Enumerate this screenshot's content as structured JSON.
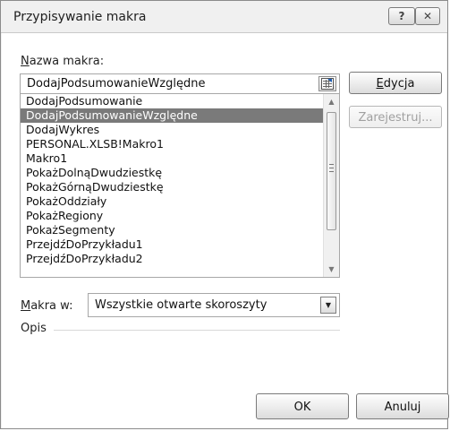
{
  "window": {
    "title": "Przypisywanie makra",
    "help_symbol": "?",
    "close_symbol": "✕"
  },
  "macro_name": {
    "label": "Nazwa makra:",
    "value": "DodajPodsumowanieWzględne"
  },
  "macros_list": {
    "items": [
      "DodajPodsumowanie",
      "DodajPodsumowanieWzględne",
      "DodajWykres",
      "PERSONAL.XLSB!Makro1",
      "Makro1",
      "PokażDolnąDwudziestkę",
      "PokażGórnąDwudziestkę",
      "PokażOddziały",
      "PokażRegiony",
      "PokażSegmenty",
      "PrzejdźDoPrzykładu1",
      "PrzejdźDoPrzykładu2"
    ],
    "selected_index": 1
  },
  "buttons": {
    "edit": "Edycja",
    "record": "Zarejestruj...",
    "ok": "OK",
    "cancel": "Anuluj"
  },
  "macros_in": {
    "label": "Makra w:",
    "selected": "Wszystkie otwarte skoroszyty"
  },
  "description": {
    "label": "Opis"
  },
  "icons": {
    "help": "help-icon",
    "close": "close-icon",
    "browse": "collapse-dialog-icon",
    "scroll_up": "chevron-up-icon",
    "scroll_down": "chevron-down-icon",
    "dropdown": "chevron-down-icon"
  },
  "colors": {
    "selected_item_bg": "#7a7a7a",
    "selected_item_text": "#ffffff",
    "disabled_text": "#a0a0a0"
  }
}
